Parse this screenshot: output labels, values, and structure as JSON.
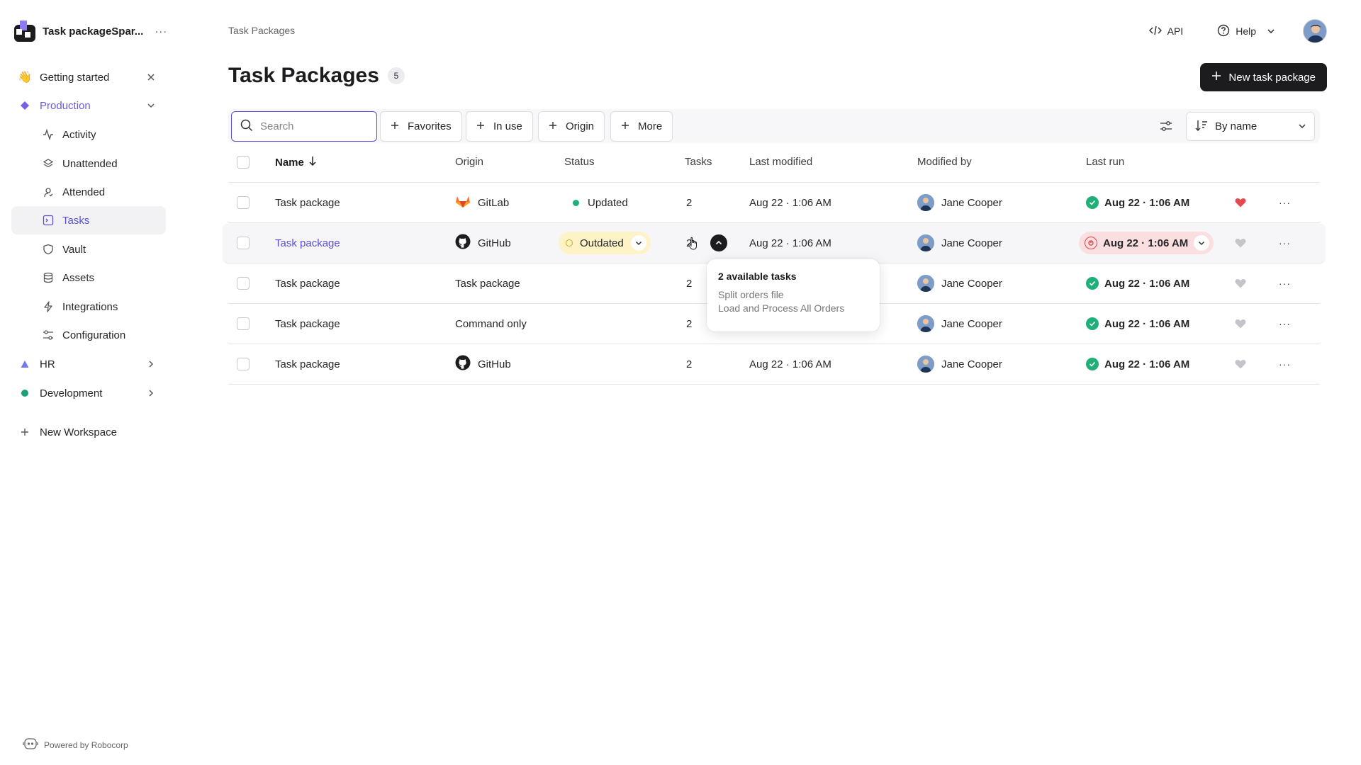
{
  "workspace": {
    "name": "Task packageSpar...",
    "more": "···"
  },
  "sidebar": {
    "getting_started": "Getting started",
    "production": "Production",
    "items": [
      {
        "label": "Activity",
        "icon": "activity-icon"
      },
      {
        "label": "Unattended",
        "icon": "layers-icon"
      },
      {
        "label": "Attended",
        "icon": "attended-icon"
      },
      {
        "label": "Tasks",
        "icon": "terminal-icon"
      },
      {
        "label": "Vault",
        "icon": "shield-icon"
      },
      {
        "label": "Assets",
        "icon": "database-icon"
      },
      {
        "label": "Integrations",
        "icon": "bolt-icon"
      },
      {
        "label": "Configuration",
        "icon": "sliders-icon"
      }
    ],
    "hr": "HR",
    "development": "Development",
    "new_workspace": "New Workspace",
    "powered_by": "Powered by Robocorp"
  },
  "header": {
    "breadcrumb": "Task Packages",
    "api": "API",
    "help": "Help"
  },
  "page": {
    "title": "Task Packages",
    "count": "5",
    "new_button": "New task package"
  },
  "toolbar": {
    "search_placeholder": "Search",
    "filters": [
      "Favorites",
      "In use",
      "Origin",
      "More"
    ],
    "sort": "By name"
  },
  "table": {
    "columns": {
      "name": "Name",
      "origin": "Origin",
      "status": "Status",
      "tasks": "Tasks",
      "last_modified": "Last modified",
      "modified_by": "Modified by",
      "last_run": "Last run"
    },
    "rows": [
      {
        "name": "Task package",
        "origin": "GitLab",
        "origin_icon": "gitlab-icon",
        "status": "Updated",
        "tasks": "2",
        "modified": "Aug 22 · 1:06 AM",
        "by": "Jane Cooper",
        "last_run": "Aug 22 · 1:06 AM",
        "favorite": true
      },
      {
        "name": "Task package",
        "origin": "GitHub",
        "origin_icon": "github-icon",
        "status": "Outdated",
        "tasks": "2",
        "modified": "Aug 22 · 1:06 AM",
        "by": "Jane Cooper",
        "last_run": "Aug 22 · 1:06 AM",
        "favorite": false
      },
      {
        "name": "Task package",
        "origin": "Task package",
        "origin_icon": "",
        "status": "",
        "tasks": "2",
        "modified": "",
        "by": "Jane Cooper",
        "last_run": "Aug 22 · 1:06 AM",
        "favorite": false
      },
      {
        "name": "Task package",
        "origin": "Command only",
        "origin_icon": "",
        "status": "",
        "tasks": "2",
        "modified": "",
        "by": "Jane Cooper",
        "last_run": "Aug 22 · 1:06 AM",
        "favorite": false
      },
      {
        "name": "Task package",
        "origin": "GitHub",
        "origin_icon": "github-icon",
        "status": "",
        "tasks": "2",
        "modified": "Aug 22 · 1:06 AM",
        "by": "Jane Cooper",
        "last_run": "Aug 22 · 1:06 AM",
        "favorite": false
      }
    ]
  },
  "tooltip": {
    "title": "2 available tasks",
    "lines": [
      "Split orders file",
      "Load and Process All Orders"
    ]
  },
  "colors": {
    "accent": "#5a4fd6",
    "primary_button": "#1c1c1e",
    "success": "#1fb07a",
    "warning_bg": "#fdf3c6",
    "error_bg": "#fbdfe0",
    "favorite": "#e5484d"
  }
}
